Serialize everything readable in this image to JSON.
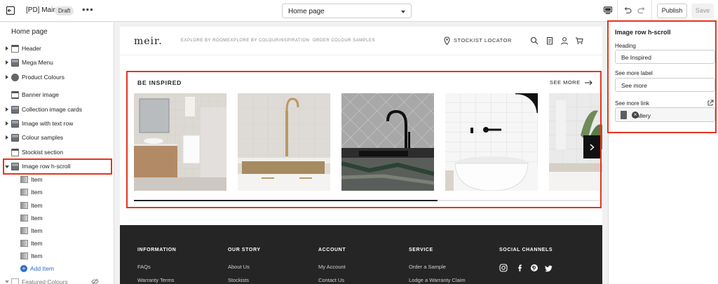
{
  "topbar": {
    "store_name": "[PD] Main",
    "status_badge": "Draft",
    "template_select": "Home page",
    "publish_label": "Publish",
    "save_label": "Save"
  },
  "sidebar": {
    "title": "Home page",
    "items": [
      {
        "label": "Header"
      },
      {
        "label": "Mega Menu"
      },
      {
        "label": "Product Colours"
      },
      {
        "label": "Banner image"
      },
      {
        "label": "Collection image cards"
      },
      {
        "label": "Image with text row"
      },
      {
        "label": "Colour samples"
      },
      {
        "label": "Stockist section"
      },
      {
        "label": "Image row h-scroll"
      }
    ],
    "sub_items": [
      "Item",
      "Item",
      "Item",
      "Item",
      "Item",
      "Item",
      "Item"
    ],
    "add_item_label": "Add Item",
    "next_section_label": "Featured Colours"
  },
  "preview": {
    "logo": "meir.",
    "nav": [
      "EXPLORE BY ROOM",
      "EXPLORE BY COLOUR",
      "INSPIRATION",
      "ORDER COLOUR SAMPLES"
    ],
    "stockist_label": "STOCKIST LOCATOR",
    "section_heading": "BE INSPIRED",
    "see_more": "SEE MORE",
    "scroll_progress": 0.65,
    "footer": {
      "columns": [
        {
          "heading": "INFORMATION",
          "links": [
            "FAQs",
            "Warranty Terms"
          ]
        },
        {
          "heading": "OUR STORY",
          "links": [
            "About Us",
            "Stockists"
          ]
        },
        {
          "heading": "ACCOUNT",
          "links": [
            "My Account",
            "Contact Us"
          ]
        },
        {
          "heading": "SERVICE",
          "links": [
            "Order a Sample",
            "Lodge a Warranty Claim"
          ]
        },
        {
          "heading": "SOCIAL CHANNELS",
          "links": []
        }
      ],
      "social_icons": [
        "instagram-icon",
        "facebook-icon",
        "pinterest-icon",
        "twitter-icon"
      ]
    }
  },
  "panel": {
    "title": "Image row h-scroll",
    "heading_label": "Heading",
    "heading_value": "Be Inspired",
    "see_more_label_label": "See more label",
    "see_more_label_value": "See more",
    "see_more_link_label": "See more link",
    "see_more_link_value": "Gallery"
  },
  "colors": {
    "highlight": "#e5351f",
    "accent_blue": "#2c6ecb",
    "footer_bg": "#252525"
  }
}
